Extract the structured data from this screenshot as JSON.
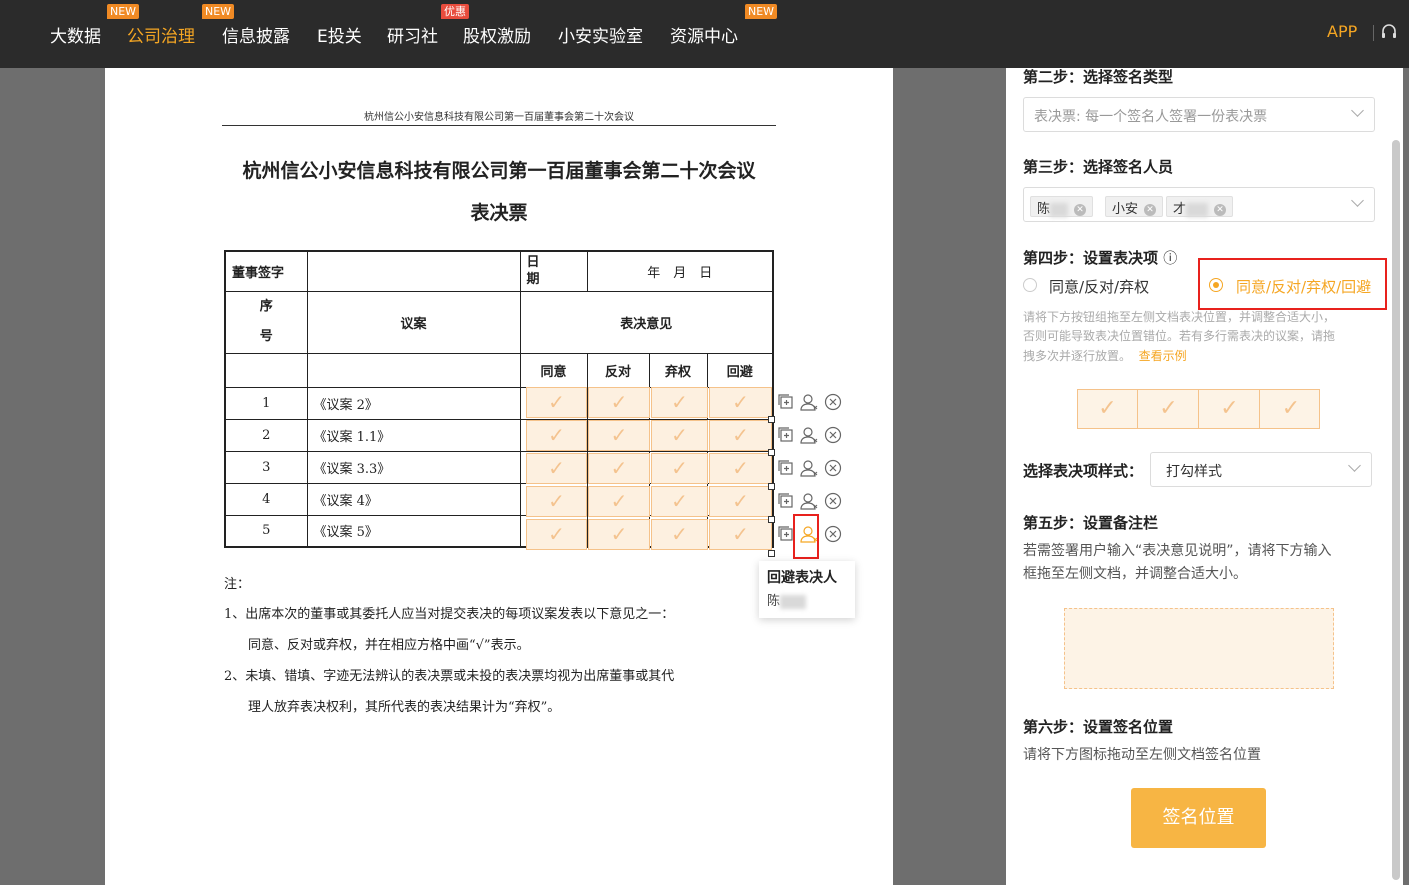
{
  "nav": {
    "items": [
      {
        "label": "大数据",
        "badge": "NEW"
      },
      {
        "label": "公司治理",
        "badge": "NEW"
      },
      {
        "label": "信息披露",
        "badge": ""
      },
      {
        "label": "E投关",
        "badge": ""
      },
      {
        "label": "研习社",
        "badge": "优惠"
      },
      {
        "label": "股权激励",
        "badge": ""
      },
      {
        "label": "小安实验室",
        "badge": ""
      },
      {
        "label": "资源中心",
        "badge": "NEW"
      }
    ],
    "app_label": "APP"
  },
  "document": {
    "header_line": "杭州信公小安信息科技有限公司第一百届董事会第二十次会议",
    "title": "杭州信公小安信息科技有限公司第一百届董事会第二十次会议",
    "subtitle": "表决票",
    "table": {
      "director_sign": "董事签字",
      "date_label_1": "日",
      "date_label_2": "期",
      "date_value": "年　月　日",
      "seq_label_1": "序",
      "seq_label_2": "号",
      "motion_label": "议案",
      "opinion_label": "表决意见",
      "vote_columns": [
        "同意",
        "反对",
        "弃权",
        "回避"
      ],
      "rows": [
        {
          "no": "1",
          "motion": "《议案 2》"
        },
        {
          "no": "2",
          "motion": "《议案 1.1》"
        },
        {
          "no": "3",
          "motion": "《议案 3.3》"
        },
        {
          "no": "4",
          "motion": "《议案 4》"
        },
        {
          "no": "5",
          "motion": "《议案 5》"
        }
      ]
    },
    "check_mark": "✓",
    "tooltip": {
      "title": "回避表决人",
      "name": "陈"
    },
    "notes": {
      "label": "注：",
      "line1": "1、出席本次的董事或其委托人应当对提交表决的每项议案发表以下意见之一：",
      "line2": "同意、反对或弃权，并在相应方格中画“√”表示。",
      "line3": "2、未填、错填、字迹无法辨认的表决票或未投的表决票均视为出席董事或其代",
      "line4": "理人放弃表决权利，其所代表的表决结果计为“弃权”。"
    }
  },
  "panel": {
    "step2": {
      "title": "第二步：选择签名类型",
      "value": "表决票: 每一个签名人签署一份表决票"
    },
    "step3": {
      "title": "第三步：选择签名人员",
      "tags": [
        "陈",
        "小安",
        "才"
      ]
    },
    "step4": {
      "title": "第四步：设置表决项",
      "info_icon": "ⓘ",
      "option1": "同意/反对/弃权",
      "option2": "同意/反对/弃权/回避",
      "hint1": "请将下方按钮组拖至左侧文档表决位置，并调整合适大小，",
      "hint2": "否则可能导致表决位置错位。若有多行需表决的议案，请拖",
      "hint3": "拽多次并逐行放置。",
      "hint_link": "查看示例"
    },
    "style": {
      "label": "选择表决项样式：",
      "value": "打勾样式"
    },
    "step5": {
      "title": "第五步：设置备注栏",
      "desc1": "若需签署用户输入“表决意见说明”，请将下方输入",
      "desc2": "框拖至左侧文档，并调整合适大小。"
    },
    "step6": {
      "title": "第六步：设置签名位置",
      "desc": "请将下方图标拖动至左侧文档签名位置",
      "button": "签名位置"
    }
  },
  "colors": {
    "accent": "#f5a623",
    "highlight": "#e8211d",
    "nav_bg": "#2b2b2b"
  }
}
